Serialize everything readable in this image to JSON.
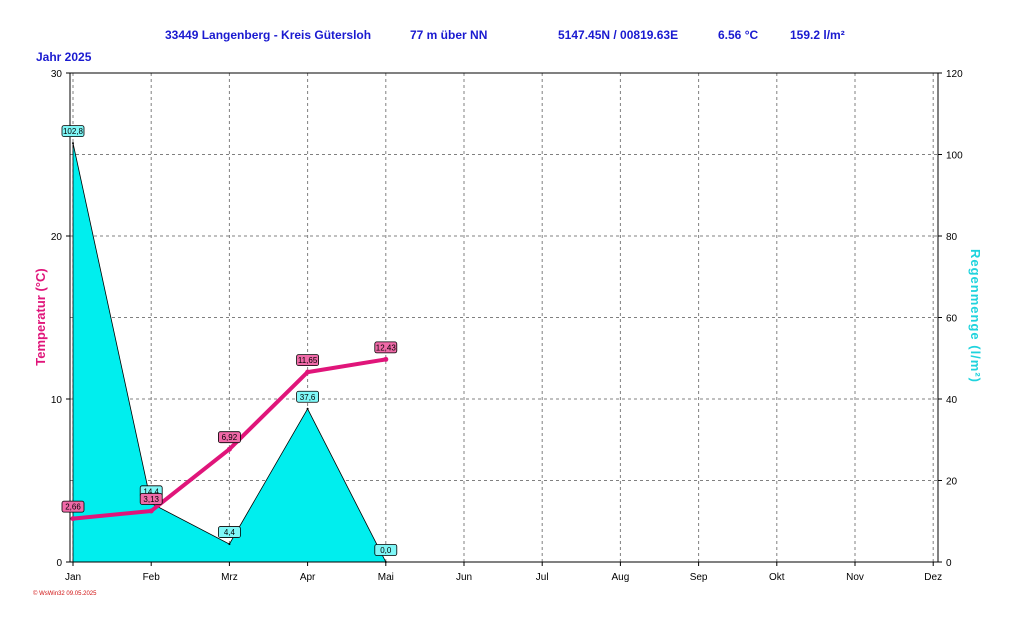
{
  "header": {
    "station": "33449 Langenberg - Kreis Gütersloh",
    "elevation": "77 m über NN",
    "coords": "5147.45N / 00819.63E",
    "mean_temp": "6.56 °C",
    "total_rain": "159.2 l/m²",
    "year_label": "Jahr  2025"
  },
  "footer": {
    "credit": "© WsWin32  09.05.2025"
  },
  "colors": {
    "header_text": "#1a1ad0",
    "temperature": "#e0157a",
    "rain": "#00eeee",
    "grid": "#808080"
  },
  "chart_data": {
    "type": "area",
    "categories": [
      "Jan",
      "Feb",
      "Mrz",
      "Apr",
      "Mai",
      "Jun",
      "Jul",
      "Aug",
      "Sep",
      "Okt",
      "Nov",
      "Dez"
    ],
    "ylabel_left": "Temperatur  (°C)",
    "ylabel_right": "Regenmenge  (l/m²)",
    "ylim_left": [
      0,
      30
    ],
    "ylim_right": [
      0,
      120
    ],
    "yticks_left": [
      "0",
      "10",
      "20",
      "30"
    ],
    "yticks_right": [
      "0",
      "20",
      "40",
      "60",
      "80",
      "100",
      "120"
    ],
    "grid": true,
    "series": [
      {
        "name": "Temperatur",
        "type": "line",
        "axis": "left",
        "values": [
          2.66,
          3.13,
          6.92,
          11.65,
          12.43
        ],
        "labels": [
          "2,66",
          "3,13",
          "6,92",
          "11,65",
          "12,43"
        ]
      },
      {
        "name": "Regenmenge",
        "type": "area",
        "axis": "right",
        "values": [
          102.8,
          14.4,
          4.4,
          37.6,
          0.0
        ],
        "labels": [
          "102,8",
          "14,4",
          "4,4",
          "37,6",
          "0,0"
        ]
      }
    ]
  }
}
